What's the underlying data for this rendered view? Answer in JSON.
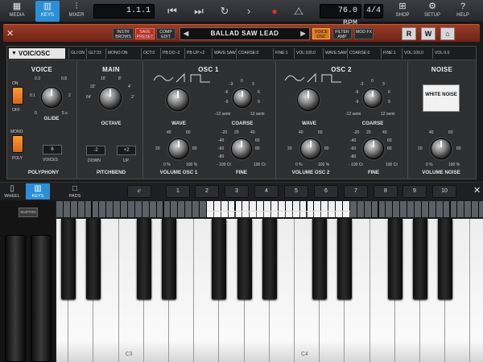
{
  "toolbar": {
    "media": "MEDIA",
    "keys": "KEYS",
    "mixer": "MIXER",
    "position": "1.1.1",
    "tempo": "76.0 BPM",
    "time_signature": "4/4",
    "shop": "SHOP",
    "setup": "SETUP",
    "help": "HELP"
  },
  "instrument": {
    "buttons": [
      "INSTR BROWS",
      "SAVE PRESET",
      "COMP EDIT"
    ],
    "preset_name": "BALLAD SAW LEAD",
    "view_buttons": [
      "VOICE OSC",
      "FILTER AMP",
      "MOD FX"
    ],
    "letter_buttons": [
      "R",
      "W"
    ]
  },
  "panel": {
    "tab": "VOIC/OSC",
    "status": [
      "GLI:ON",
      "GLT:23",
      "MONO:ON",
      "OCT:0",
      "PB DO:-2",
      "PB UP:+2",
      "WAVE:SAW",
      "COARSE:0",
      "FINE:1",
      "VOL:100.0",
      "WAVE:SAW",
      "COARSE:0",
      "FINE:1",
      "VOL:100.0",
      "VOL:0.0"
    ],
    "voice": {
      "title": "VOICE",
      "on": "ON",
      "off": "OFF",
      "glide": "GLIDE",
      "glide_scale": [
        "0.3",
        "0.8",
        "0.1",
        "2",
        "0",
        "5 s"
      ],
      "mono": "MONO",
      "poly": "POLY",
      "voices_value": "6",
      "voices": "VOICES",
      "polyphony": "POLYPHONY"
    },
    "main": {
      "title": "MAIN",
      "octave": "OCTAVE",
      "octave_scale": [
        "16'",
        "8'",
        "32'",
        "4'",
        "64'",
        "2'"
      ],
      "down_value": "-2",
      "up_value": "+2",
      "down": "DOWN",
      "up": "UP",
      "pitchbend": "PITCHBEND"
    },
    "osc1": {
      "title": "OSC 1",
      "wave": "WAVE",
      "coarse": "COARSE",
      "coarse_scale": [
        "0",
        "-3",
        "3",
        "-6",
        "6",
        "-9",
        "9",
        "-12 semi",
        "12 semi"
      ],
      "volume": "VOLUME OSC 1",
      "volume_scale": [
        "40",
        "60",
        "20",
        "80",
        "0 %",
        "100 %"
      ],
      "fine": "FINE",
      "fine_scale": [
        "20",
        "-20",
        "40",
        "-40",
        "60",
        "-60",
        "80",
        "-80",
        "- 100 Ct",
        "100 Ct"
      ]
    },
    "osc2": {
      "title": "OSC 2",
      "wave": "WAVE",
      "coarse": "COARSE",
      "coarse_scale": [
        "0",
        "-3",
        "3",
        "-6",
        "6",
        "-9",
        "9",
        "-12 semi",
        "12 semi"
      ],
      "volume": "VOLUME OSC 2",
      "volume_scale": [
        "40",
        "60",
        "20",
        "80",
        "0 %",
        "100 %"
      ],
      "fine": "FINE",
      "fine_scale": [
        "20",
        "-20",
        "40",
        "-40",
        "60",
        "-60",
        "80",
        "-80",
        "- 100 Ct",
        "100 Ct"
      ]
    },
    "noise": {
      "title": "NOISE",
      "white_noise": "WHITE NOISE",
      "volume": "VOLUME NOISE",
      "volume_scale": [
        "40",
        "60",
        "20",
        "80",
        "0 %",
        "100 %"
      ]
    }
  },
  "keyboard_bar": {
    "wheel": "WHEEL",
    "keys": "KEYS",
    "pads": "PADS",
    "chords": [
      "1",
      "2",
      "3",
      "4",
      "5",
      "6",
      "7",
      "8",
      "9",
      "10"
    ]
  },
  "wheels": {
    "sustain": "SUSTAIN"
  },
  "keyboard": {
    "labels": [
      "C3",
      "C4"
    ]
  }
}
